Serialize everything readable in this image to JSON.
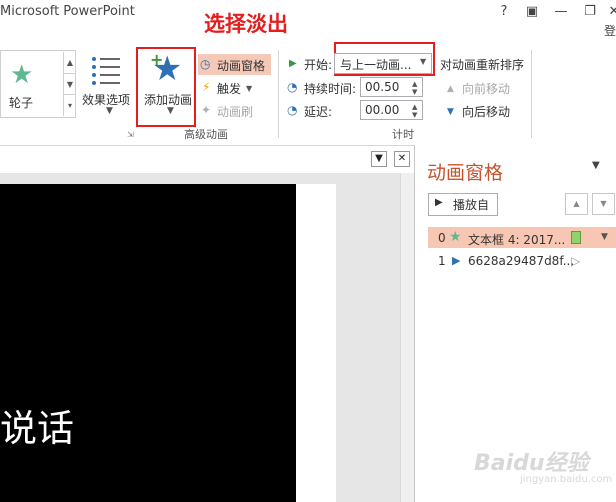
{
  "title_bar": {
    "app_title": "Microsoft PowerPoint",
    "help_label": "?",
    "ribbon_display_label": "▣",
    "minimize_label": "—",
    "restore_label": "❐",
    "close_label": "✕",
    "signin_label": "登"
  },
  "annotation": {
    "text": "选择淡出"
  },
  "ribbon": {
    "gallery": {
      "item_label": "轮子"
    },
    "effect_options_label": "效果选项",
    "add_animation_label": "添加动画",
    "animation_pane_label": "动画窗格",
    "trigger_label": "触发",
    "animation_painter_label": "动画刷",
    "advanced_group_label": "高级动画",
    "timing": {
      "start_label": "开始:",
      "start_value": "与上一动画...",
      "duration_label": "持续时间:",
      "duration_value": "00.50",
      "delay_label": "延迟:",
      "delay_value": "00.00",
      "reorder_label": "对动画重新排序",
      "move_earlier_label": "向前移动",
      "move_later_label": "向后移动",
      "group_label": "计时"
    }
  },
  "slide": {
    "text": "说话"
  },
  "animation_pane": {
    "title": "动画窗格",
    "play_label": "播放自",
    "items": [
      {
        "index": "0",
        "label": "文本框 4: 2017..."
      },
      {
        "index": "1",
        "label": "6628a29487d8f..."
      }
    ]
  },
  "watermark": {
    "text": "Baidu经验",
    "sub": "jingyan.baidu.com"
  },
  "colors": {
    "annotation_red": "#e41e1e",
    "selection": "#f7c7b4",
    "pane_title": "#c8532c",
    "star_blue": "#2f6fb3"
  }
}
